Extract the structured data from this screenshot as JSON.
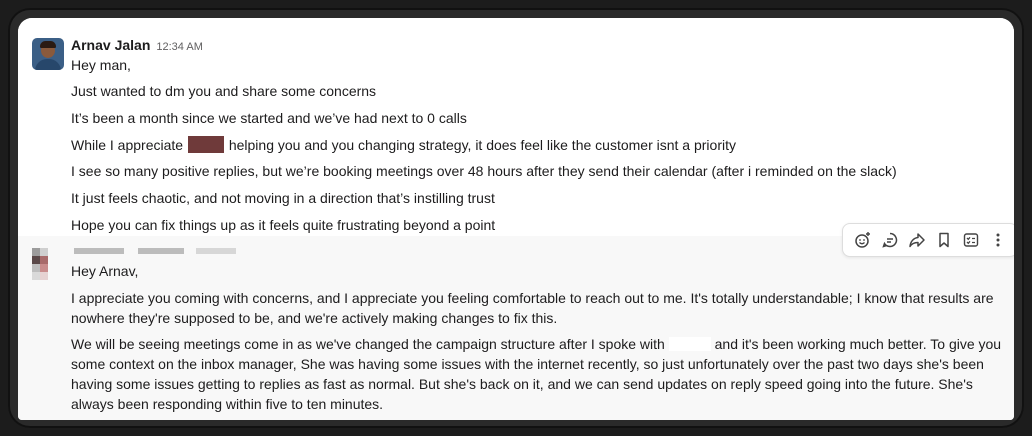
{
  "message1": {
    "author": "Arnav Jalan",
    "time": "12:34 AM",
    "lines": [
      "Hey man,",
      "Just wanted to dm you and share some concerns",
      "It’s been a month since we started and we’ve had next to 0 calls",
      "I see so many positive replies, but we’re booking meetings over 48 hours after they send their calendar (after i reminded on the slack)",
      "It just feels chaotic, and not moving in a direction that’s instilling trust",
      "Hope you can fix things up as it feels quite frustrating beyond a point"
    ],
    "line4_before": "While I appreciate",
    "line4_after": " helping you and you changing strategy, it does feel like the customer isnt a priority"
  },
  "message2": {
    "greeting": "Hey Arnav,",
    "para1": "I appreciate you coming with concerns, and I appreciate you feeling comfortable to reach out to me. It's totally understandable; I know that results are nowhere they're supposed to be, and we're actively making changes to fix this.",
    "para2_before": "We will be seeing meetings come in as we've changed the campaign structure after I spoke with",
    "para2_after": " and it's been working much better. To give you some context on the inbox manager, She was having some issues with the internet recently, so just unfortunately over the past two days she's been having some issues getting to replies as fast as normal. But she's back on it, and we can send updates on reply speed going into the future. She's always been responding within five to ten minutes."
  },
  "toolbar": {
    "icons": [
      "add-reaction-icon",
      "reply-in-thread-icon",
      "share-icon",
      "bookmark-icon",
      "add-to-list-icon",
      "more-actions-icon"
    ]
  },
  "colors": {
    "redaction": "#6f3a3a",
    "hover_background": "#f8f8f8"
  }
}
